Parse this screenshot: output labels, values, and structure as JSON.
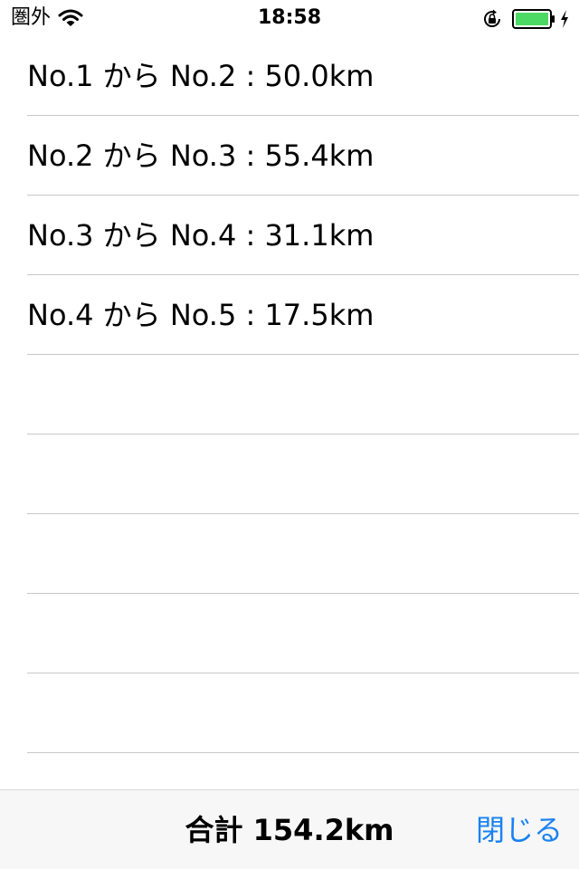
{
  "status_bar": {
    "carrier": "圏外",
    "time": "18:58",
    "icons": [
      "wifi-icon",
      "orientation-lock-icon",
      "battery-icon",
      "charging-bolt-icon"
    ],
    "battery_color": "#4cd964"
  },
  "segments": [
    {
      "label": "No.1 から No.2 : 50.0km"
    },
    {
      "label": "No.2 から No.3 : 55.4km"
    },
    {
      "label": "No.3 から No.4 : 31.1km"
    },
    {
      "label": "No.4 から No.5 : 17.5km"
    },
    {
      "label": ""
    },
    {
      "label": ""
    },
    {
      "label": ""
    },
    {
      "label": ""
    },
    {
      "label": ""
    }
  ],
  "toolbar": {
    "total_label": "合計 154.2km",
    "close_label": "閉じる",
    "accent_color": "#1a82f0"
  }
}
